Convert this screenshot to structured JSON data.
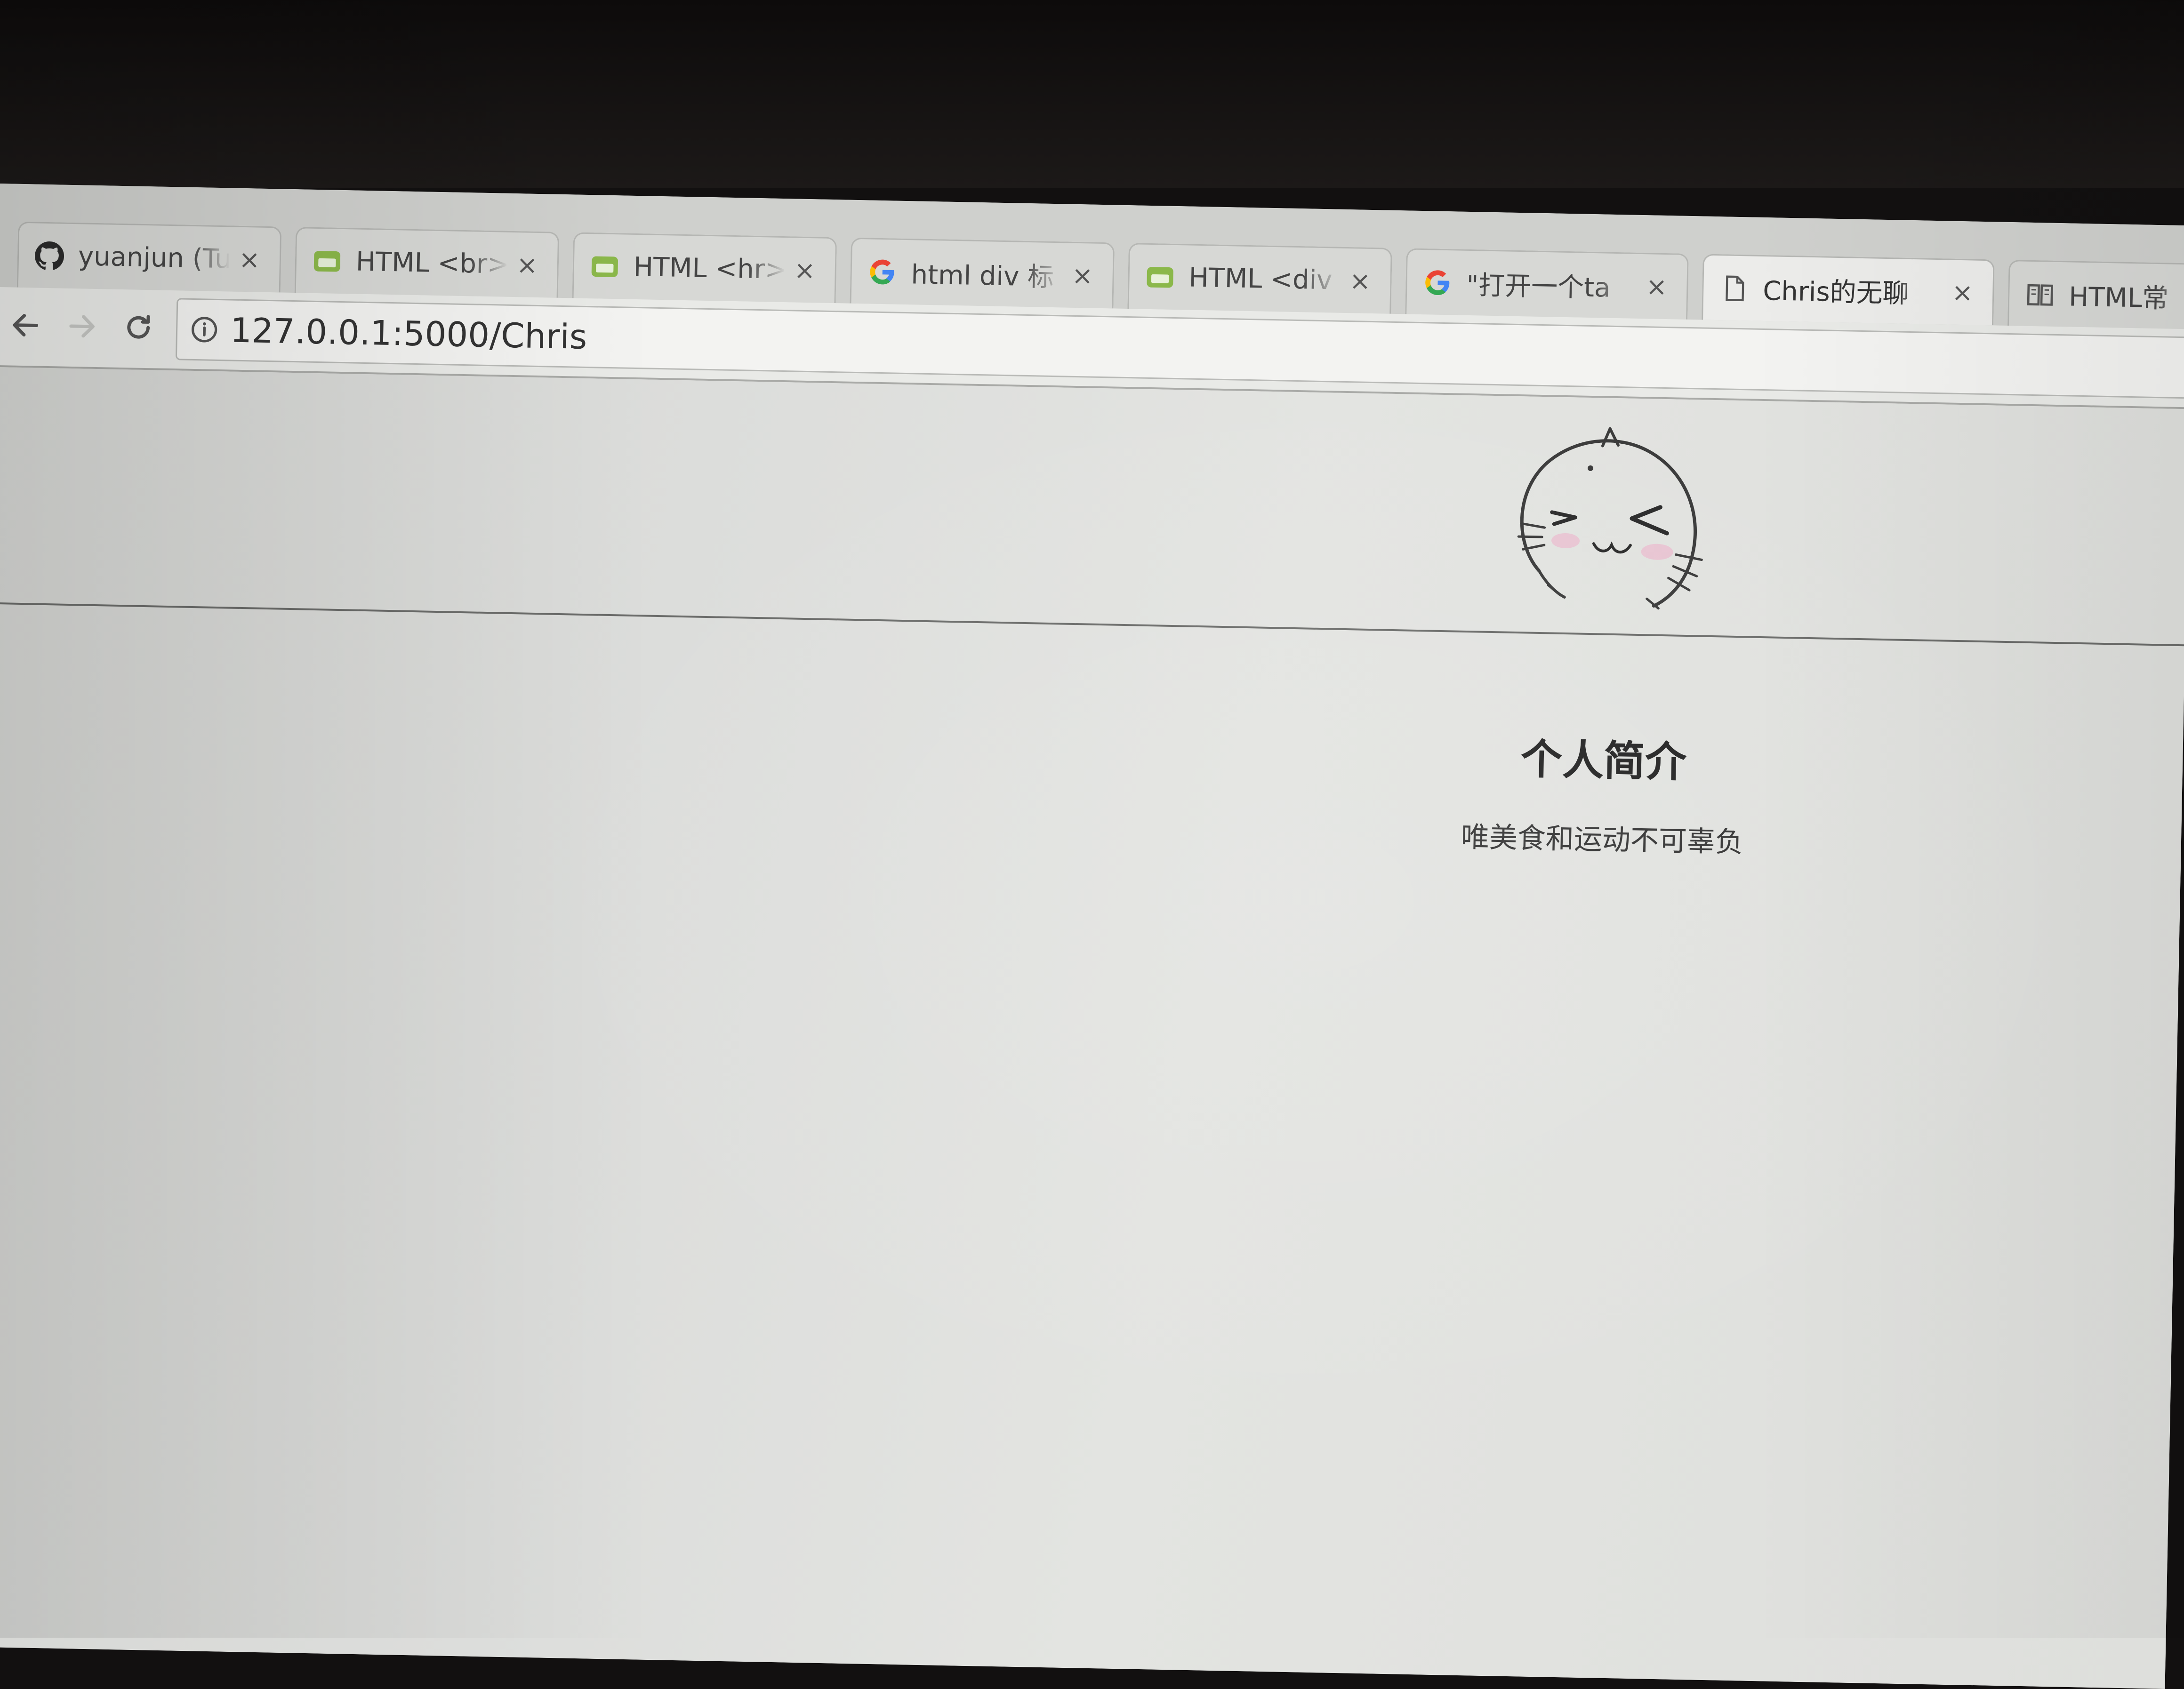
{
  "browser": {
    "tabs": [
      {
        "title": "yuanjun (Tu",
        "icon": "github-icon",
        "active": false
      },
      {
        "title": "HTML <br>",
        "icon": "runoob-icon",
        "active": false
      },
      {
        "title": "HTML <hr>",
        "icon": "runoob-icon",
        "active": false
      },
      {
        "title": "html div 标",
        "icon": "google-icon",
        "active": false
      },
      {
        "title": "HTML <div",
        "icon": "runoob-icon",
        "active": false
      },
      {
        "title": "\"打开一个ta",
        "icon": "google-icon",
        "active": false
      },
      {
        "title": "Chris的无聊",
        "icon": "document-icon",
        "active": true
      },
      {
        "title": "HTML常",
        "icon": "book-icon",
        "active": false
      }
    ],
    "close_glyph": "×",
    "address_bar": {
      "url": "127.0.0.1:5000/Chris"
    }
  },
  "page": {
    "avatar_alt": "cartoon cat avatar",
    "profile_title": "个人简介",
    "profile_bio": "唯美食和运动不可辜负"
  },
  "colors": {
    "github": "#222222",
    "runoob": "#8bb84a",
    "google_blue": "#4285f4",
    "google_red": "#ea4335",
    "google_yellow": "#fbbc05",
    "google_green": "#34a853"
  }
}
